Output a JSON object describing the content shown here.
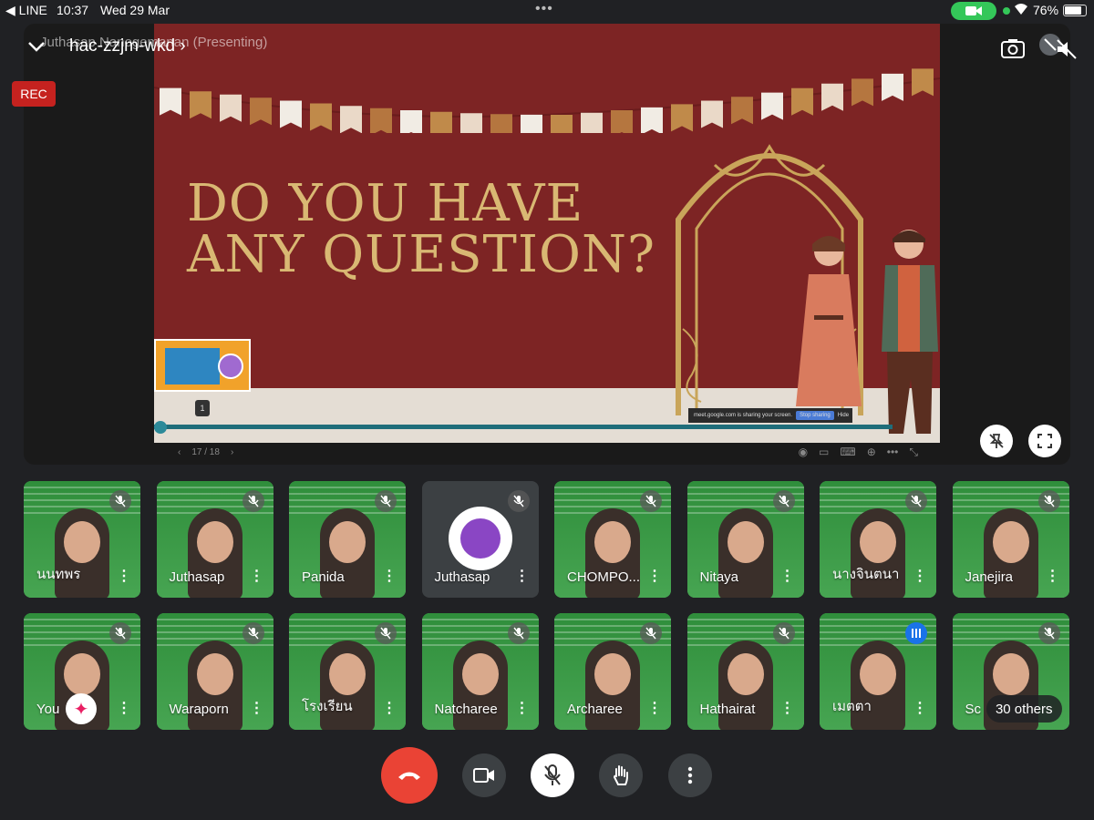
{
  "status_bar": {
    "back_app": "◀ LINE",
    "time": "10:37",
    "date": "Wed 29 Mar",
    "battery": "76%"
  },
  "meeting": {
    "presenter_label": "Juthasap Nanogemanan (Presenting)",
    "code": "hac-zzjm-wkd",
    "rec_label": "REC"
  },
  "slide": {
    "title_line1": "DO YOU HAVE",
    "title_line2": "ANY QUESTION?",
    "page_indicator": "1",
    "page_counter": "17 / 18",
    "share_text": "meet.google.com is sharing your screen.",
    "stop_sharing": "Stop sharing",
    "hide": "Hide"
  },
  "participants_row1": [
    {
      "name": "นนทพร",
      "muted": true
    },
    {
      "name": "Juthasap",
      "muted": true
    },
    {
      "name": "Panida",
      "muted": true
    },
    {
      "name": "Juthasap",
      "muted": true,
      "avatar": true
    },
    {
      "name": "CHOMPO...",
      "muted": true
    },
    {
      "name": "Nitaya",
      "muted": true
    },
    {
      "name": "นางจินตนา",
      "muted": true
    },
    {
      "name": "Janejira",
      "muted": true
    }
  ],
  "participants_row2": [
    {
      "name": "You",
      "muted": true
    },
    {
      "name": "Waraporn",
      "muted": true
    },
    {
      "name": "โรงเรียน",
      "muted": true
    },
    {
      "name": "Natcharee",
      "muted": true
    },
    {
      "name": "Archaree",
      "muted": true
    },
    {
      "name": "Hathairat",
      "muted": true
    },
    {
      "name": "เมตตา",
      "speaking": true
    },
    {
      "name": "Sc",
      "muted": true
    }
  ],
  "others_label": "30 others",
  "colors": {
    "hangup": "#ea4335",
    "rec": "#c5221f",
    "speaking": "#1a73e8",
    "slide_bg": "#7d2424",
    "slide_title": "#d9b873"
  }
}
